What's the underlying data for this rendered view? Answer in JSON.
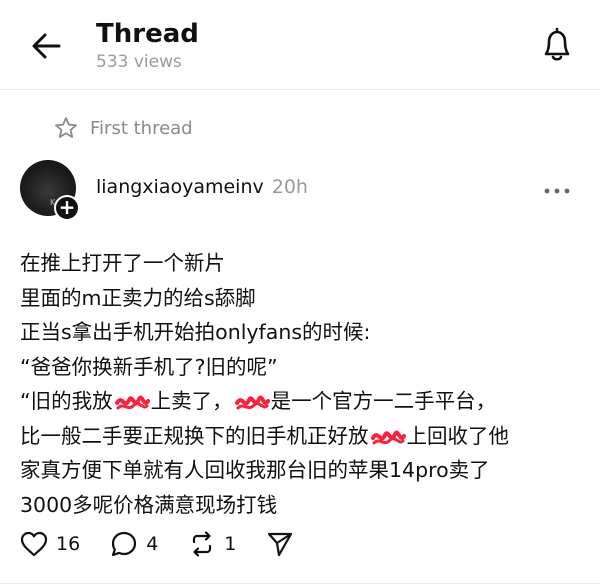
{
  "header": {
    "title": "Thread",
    "views": "533 views"
  },
  "first_thread_label": "First thread",
  "post": {
    "username": "liangxiaoyameinv",
    "time": "20h",
    "avatar_tag": "K",
    "lines": [
      [
        "在推上打开了一个新片"
      ],
      [
        "里面的m正卖力的给s舔脚"
      ],
      [
        "正当s拿出手机开始拍onlyfans的时候:"
      ],
      [
        "“爸爸你换新手机了?旧的呢”"
      ],
      [
        "“旧的我放",
        "上卖了，",
        "是一个官方一二手平台，"
      ],
      [
        "比一般二手要正规换下的旧手机正好放",
        "上回收了他"
      ],
      [
        "家真方便下单就有人回收我那台旧的苹果14pro卖了"
      ],
      [
        "3000多呢价格满意现场打钱"
      ]
    ]
  },
  "actions": {
    "likes": "16",
    "replies": "4",
    "reposts": "1"
  },
  "colors": {
    "censor_scribble": "#ff1f3d",
    "muted_text": "#9a9a9a"
  }
}
